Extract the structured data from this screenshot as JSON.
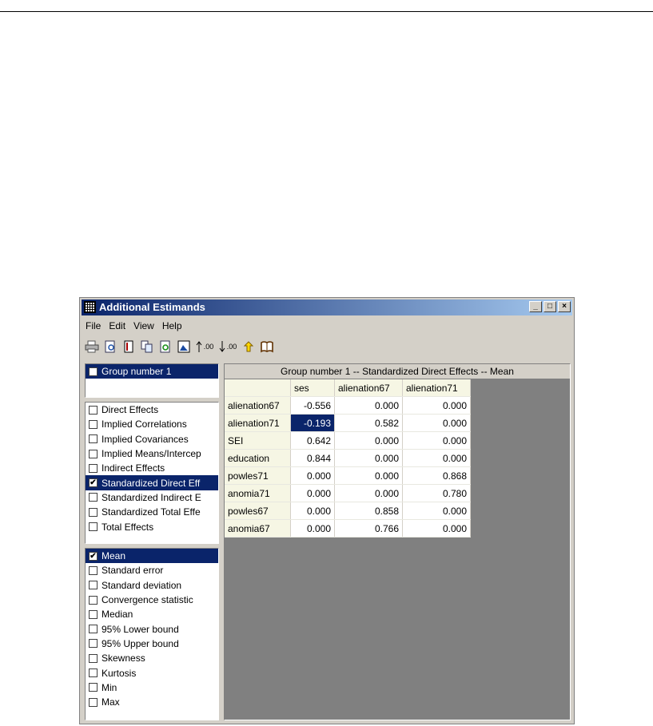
{
  "window": {
    "title": "Additional Estimands",
    "controls": [
      "_",
      "□",
      "×"
    ]
  },
  "menu": [
    "File",
    "Edit",
    "View",
    "Help"
  ],
  "toolbar": [
    "print-icon",
    "preview-icon",
    "copy-page-icon",
    "copy-icon",
    "refresh-icon",
    "picture-icon",
    "increase-decimals-icon",
    "decrease-decimals-icon",
    "help-icon",
    "book-icon"
  ],
  "toolbar_labels": {
    "increase": ".00",
    "decrease": ".00"
  },
  "groups": [
    {
      "label": "Group number 1",
      "checked": false,
      "selected": true
    }
  ],
  "estimands": [
    {
      "label": "Direct Effects",
      "checked": false
    },
    {
      "label": "Implied Correlations",
      "checked": false
    },
    {
      "label": "Implied Covariances",
      "checked": false
    },
    {
      "label": "Implied Means/Intercep",
      "checked": false
    },
    {
      "label": "Indirect Effects",
      "checked": false
    },
    {
      "label": "Standardized Direct Eff",
      "checked": true,
      "selected": true
    },
    {
      "label": "Standardized Indirect E",
      "checked": false
    },
    {
      "label": "Standardized Total Effe",
      "checked": false
    },
    {
      "label": "Total Effects",
      "checked": false
    }
  ],
  "statistics": [
    {
      "label": "Mean",
      "checked": true,
      "selected": true
    },
    {
      "label": "Standard error",
      "checked": false
    },
    {
      "label": "Standard deviation",
      "checked": false
    },
    {
      "label": "Convergence statistic",
      "checked": false
    },
    {
      "label": "Median",
      "checked": false
    },
    {
      "label": "95% Lower bound",
      "checked": false
    },
    {
      "label": "95% Upper bound",
      "checked": false
    },
    {
      "label": "Skewness",
      "checked": false
    },
    {
      "label": "Kurtosis",
      "checked": false
    },
    {
      "label": "Min",
      "checked": false
    },
    {
      "label": "Max",
      "checked": false
    }
  ],
  "grid": {
    "header": "Group number 1 -- Standardized Direct Effects -- Mean",
    "columns": [
      "ses",
      "alienation67",
      "alienation71"
    ],
    "rows": [
      {
        "label": "alienation67",
        "values": [
          "-0.556",
          "0.000",
          "0.000"
        ]
      },
      {
        "label": "alienation71",
        "values": [
          "-0.193",
          "0.582",
          "0.000"
        ],
        "selected_col": 0
      },
      {
        "label": "SEI",
        "values": [
          "0.642",
          "0.000",
          "0.000"
        ]
      },
      {
        "label": "education",
        "values": [
          "0.844",
          "0.000",
          "0.000"
        ]
      },
      {
        "label": "powles71",
        "values": [
          "0.000",
          "0.000",
          "0.868"
        ]
      },
      {
        "label": "anomia71",
        "values": [
          "0.000",
          "0.000",
          "0.780"
        ]
      },
      {
        "label": "powles67",
        "values": [
          "0.000",
          "0.858",
          "0.000"
        ]
      },
      {
        "label": "anomia67",
        "values": [
          "0.000",
          "0.766",
          "0.000"
        ]
      }
    ]
  },
  "colors": {
    "selection": "#0a246a",
    "window_face": "#d4d0c8",
    "grid_background": "#808080"
  }
}
